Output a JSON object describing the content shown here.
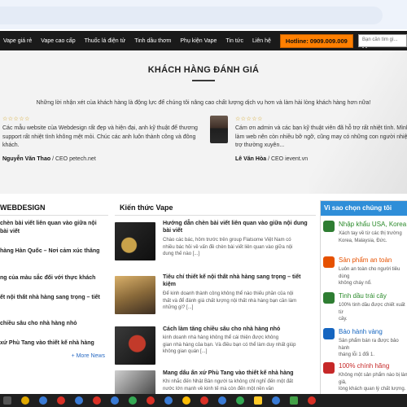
{
  "nav": {
    "items": [
      "Vape giá rẻ",
      "Vape cao cấp",
      "Thuốc lá điện tử",
      "Tinh dầu thơm",
      "Phụ kiện Vape",
      "Tin tức",
      "Liên hệ"
    ],
    "hotline": "Hotline: 0909.009.009",
    "search_placeholder": "Bạn cần tìm gì..."
  },
  "reviews": {
    "title": "KHÁCH HÀNG ĐÁNH GIÁ",
    "intro": "Những lời nhận xét của khách hàng là động lực để chúng tôi nâng cao chất lượng dịch vụ hơn và làm hài lòng khách hàng hơn nữa!",
    "stars": "☆☆☆☆☆",
    "items": [
      {
        "text_1": "Các mẫu website của Webdesign rất đẹp và hiện đại, anh kỹ thuật để thương",
        "text_2": "support rất nhiệt tình không mệt mỏi. Chúc các anh luôn thành công và đông",
        "text_3": "khách.",
        "name": "Nguyễn Văn Thao",
        "company": " / CEO petech.net"
      },
      {
        "text_1": "Cám ơn admin và các bạn kỹ thuật viên đã hỗ trợ rất nhiệt tình. Mình",
        "text_2": "làm web nên còn nhiều bỡ ngỡ, cũng may có những con người nhiệt",
        "text_3": "trợ thường xuyên...",
        "name": "Lê Văn Hòa",
        "company": " / CEO ievent.vn"
      }
    ]
  },
  "left": {
    "title": "WEBDESIGN",
    "items": [
      {
        "l1": "chèn bài viết liên quan vào giữa nội",
        "l2": "bài viết"
      },
      {
        "l1": "hàng Hàn Quốc – Nơi cảm xúc thăng",
        "l2": ""
      },
      {
        "l1": "ng của màu sắc đối với thực khách",
        "l2": ""
      },
      {
        "l1": "ết nội thất nhà hàng sang trọng – tiết",
        "l2": ""
      },
      {
        "l1": "chiều sâu cho nhà hàng nhỏ",
        "l2": ""
      },
      {
        "l1": "xứ Phù Tang vào thiết kế nhà hàng",
        "l2": ""
      }
    ],
    "more": "+ More News"
  },
  "middle": {
    "title": "Kiến thức Vape",
    "posts": [
      {
        "t1": "Hướng dẫn chèn bài viết liên quan vào giữa nội dung",
        "t2": "bài viết",
        "e1": "Chào các bác, hôm trước trên group Flatsome Việt Nam có",
        "e2": "nhiều bác hỏi về vấn đề chèn bài viết liên quan vào giữa nội",
        "e3": "dung thế nào [...]"
      },
      {
        "t1": "Tiêu chí thiết kế nội thất nhà hàng sang trọng – tiết",
        "t2": "kiệm",
        "e1": "Để kinh doanh thành công không thể nào thiếu phần của nội",
        "e2": "thất và để đánh giá  chất lượng  nội thất nhà hàng bạn cần làm",
        "e3": "những gì? [...]"
      },
      {
        "t1": "Cách làm tăng chiều sâu cho nhà hàng nhỏ",
        "t2": "",
        "e1": "kinh doanh nhà hàng không thể cái thiện được không",
        "e2": "gian nhà hàng của bạn. Và điều bạn có thể làm duy nhất giúp",
        "e3": "không gian quán [...]"
      },
      {
        "t1": "Mang dấu ấn xứ Phù Tang vào thiết kế nhà hàng",
        "t2": "",
        "e1": "Khi nhắc đến Nhật Bản người ta không chỉ nghĩ đến một đất",
        "e2": "nước lớn mạnh về kinh tế mà còn đến một nền văn",
        "e3": ""
      }
    ]
  },
  "right": {
    "title": "Vì sao chọn chúng tôi",
    "reasons": [
      {
        "title": "Nhập khẩu USA, Korea",
        "d1": "Xách tay về từ các thị trường",
        "d2": "Korea, Malaysia, Đức.",
        "color": "#2e7d32",
        "icon": "globe-icon"
      },
      {
        "title": "Sản phẩm an toàn",
        "d1": "Luôn an toàn cho người tiêu dùng",
        "d2": "không cháy nổ.",
        "color": "#e65100",
        "icon": "shield-icon"
      },
      {
        "title": "Tinh dầu trái cây",
        "d1": "100% tinh dầu được chiết xuất từ",
        "d2": "cây.",
        "color": "#2e7d32",
        "icon": "drop-icon"
      },
      {
        "title": "Bảo hành vàng",
        "d1": "Sản phẩm bán ra được bảo hành",
        "d2": "tháng lỗi 1 đổi 1.",
        "color": "#1565c0",
        "icon": "award-icon"
      },
      {
        "title": "100% chính hãng",
        "d1": "Không một sản phẩm nào bị làm giả,",
        "d2": "lòng khách quan lý chất lượng.",
        "color": "#c62828",
        "icon": "badge-icon"
      }
    ]
  }
}
